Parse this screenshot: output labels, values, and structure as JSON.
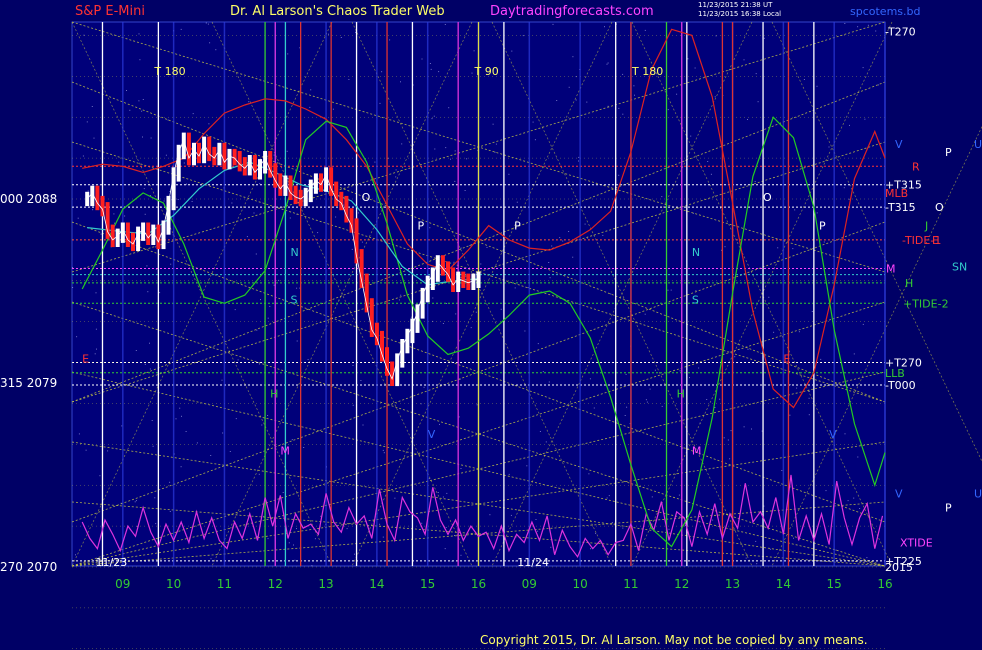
{
  "header": {
    "symbol": "S&P E-Mini",
    "title": "Dr. Al Larson's Chaos Trader Web",
    "site": "Daytradingforecasts.com",
    "stamp1": "11/23/2015 21:38 UT",
    "stamp2": "11/23/2015 16:38 Local",
    "file": "spcotems.bd"
  },
  "copyright": "Copyright 2015, Dr. Al Larson. May not be copied by any means.",
  "colors": {
    "background": "#000066",
    "plot_bg": "#00007a",
    "price_up": "#ffffff",
    "price_down": "#ff2020",
    "grid_yellow": "#d8d840",
    "red_line": "#dd2222",
    "green_line": "#22cc22",
    "cyan_line": "#33cccc",
    "magenta_line": "#dd33dd"
  },
  "chart_data": {
    "type": "line",
    "y_tick_labels": [
      {
        "text": "000  2088",
        "value": 2088
      },
      {
        "text": "315  2079",
        "value": 2079
      },
      {
        "text": "270  2070",
        "value": 2070
      }
    ],
    "ylim": [
      2070,
      2088
    ],
    "day_labels": [
      {
        "text": "11/23",
        "hour": 8.5
      },
      {
        "text": "11/24",
        "hour": 16.8
      }
    ],
    "x_ticks": [
      {
        "text": "09",
        "hour": 9
      },
      {
        "text": "10",
        "hour": 10
      },
      {
        "text": "11",
        "hour": 11
      },
      {
        "text": "12",
        "hour": 12
      },
      {
        "text": "13",
        "hour": 13
      },
      {
        "text": "14",
        "hour": 14
      },
      {
        "text": "15",
        "hour": 15
      },
      {
        "text": "16",
        "hour": 16
      },
      {
        "text": "09",
        "hour": 17
      },
      {
        "text": "10",
        "hour": 18
      },
      {
        "text": "11",
        "hour": 19
      },
      {
        "text": "12",
        "hour": 20
      },
      {
        "text": "13",
        "hour": 21
      },
      {
        "text": "14",
        "hour": 22
      },
      {
        "text": "15",
        "hour": 23
      },
      {
        "text": "16",
        "hour": 24
      }
    ],
    "time_markers": [
      {
        "text": "T   180",
        "hour": 9.7
      },
      {
        "text": "T   90",
        "hour": 16.0
      },
      {
        "text": "T   180",
        "hour": 19.1
      }
    ],
    "right_labels": [
      {
        "text": "-T270",
        "color": "#ffffff",
        "value": 2096.2
      },
      {
        "text": "V",
        "color": "#3366ff",
        "value": 2090.7
      },
      {
        "text": "P",
        "color": "#ffffff",
        "value": 2090.3
      },
      {
        "text": "U",
        "color": "#3366ff",
        "value": 2090.7
      },
      {
        "text": "R",
        "color": "#ff3333",
        "value": 2089.6
      },
      {
        "text": "+T315",
        "color": "#ffffff",
        "value": 2088.7
      },
      {
        "text": "MLB",
        "color": "#ff3333",
        "value": 2088.3
      },
      {
        "text": "O",
        "color": "#ffffff",
        "value": 2087.6
      },
      {
        "text": "-T315",
        "color": "#ffffff",
        "value": 2087.6
      },
      {
        "text": "J",
        "color": "#33cc33",
        "value": 2086.7
      },
      {
        "text": "-TIDE-1",
        "color": "#ff3333",
        "value": 2086.0
      },
      {
        "text": "E",
        "color": "#ff3333",
        "value": 2086.0
      },
      {
        "text": "M",
        "color": "#ff44ff",
        "value": 2084.6
      },
      {
        "text": "SN",
        "color": "#33cccc",
        "value": 2084.7
      },
      {
        "text": "H",
        "color": "#33cc33",
        "value": 2083.9
      },
      {
        "text": "+TIDE-2",
        "color": "#33cc33",
        "value": 2082.9
      },
      {
        "text": "+T270",
        "color": "#ffffff",
        "value": 2080.0
      },
      {
        "text": "LLB",
        "color": "#33cc33",
        "value": 2079.5
      },
      {
        "text": "-T000",
        "color": "#ffffff",
        "value": 2078.9
      },
      {
        "text": "V",
        "color": "#3366ff",
        "value": 2073.6
      },
      {
        "text": "P",
        "color": "#ffffff",
        "value": 2072.9
      },
      {
        "text": "U",
        "color": "#3366ff",
        "value": 2073.6
      },
      {
        "text": "XTIDE",
        "color": "#ff44ff",
        "value": 2071.2
      },
      {
        "text": "+T225",
        "color": "#ffffff",
        "value": 2070.3
      },
      {
        "text": "2015",
        "color": "#ffffff",
        "value": 2070.0
      }
    ],
    "plot_letters": [
      {
        "text": "O",
        "color": "#ffffff",
        "hour": 13.7,
        "value": 2087.9
      },
      {
        "text": "P",
        "color": "#ffffff",
        "hour": 14.8,
        "value": 2086.5
      },
      {
        "text": "N",
        "color": "#33cccc",
        "hour": 12.3,
        "value": 2085.2
      },
      {
        "text": "S",
        "color": "#33cccc",
        "hour": 12.3,
        "value": 2082.9
      },
      {
        "text": "H",
        "color": "#33cc33",
        "hour": 11.9,
        "value": 2078.3
      },
      {
        "text": "M",
        "color": "#ff44ff",
        "hour": 12.1,
        "value": 2075.5
      },
      {
        "text": "V",
        "color": "#3366ff",
        "hour": 15.0,
        "value": 2076.3
      },
      {
        "text": "P",
        "color": "#ffffff",
        "hour": 16.7,
        "value": 2086.5
      },
      {
        "text": "N",
        "color": "#33cccc",
        "hour": 20.2,
        "value": 2085.2
      },
      {
        "text": "S",
        "color": "#33cccc",
        "hour": 20.2,
        "value": 2082.9
      },
      {
        "text": "H",
        "color": "#33cc33",
        "hour": 19.9,
        "value": 2078.3
      },
      {
        "text": "M",
        "color": "#ff44ff",
        "hour": 20.2,
        "value": 2075.5
      },
      {
        "text": "O",
        "color": "#ffffff",
        "hour": 21.6,
        "value": 2087.9
      },
      {
        "text": "P",
        "color": "#ffffff",
        "hour": 22.7,
        "value": 2086.5
      },
      {
        "text": "V",
        "color": "#3366ff",
        "hour": 22.9,
        "value": 2076.3
      },
      {
        "text": "E",
        "color": "#ff3333",
        "hour": 22.0,
        "value": 2080.0
      },
      {
        "text": "E",
        "color": "#ff3333",
        "hour": 8.2,
        "value": 2080.0
      }
    ],
    "price_series": {
      "name": "",
      "x": [
        8.3,
        8.4,
        8.5,
        8.6,
        8.7,
        8.8,
        8.9,
        9.0,
        9.1,
        9.2,
        9.3,
        9.4,
        9.5,
        9.6,
        9.7,
        9.8,
        9.9,
        10.0,
        10.1,
        10.2,
        10.3,
        10.4,
        10.5,
        10.6,
        10.7,
        10.8,
        10.9,
        11.0,
        11.1,
        11.2,
        11.3,
        11.4,
        11.5,
        11.6,
        11.7,
        11.8,
        11.9,
        12.0,
        12.1,
        12.2,
        12.3,
        12.4,
        12.5,
        12.6,
        12.7,
        12.8,
        12.9,
        13.0,
        13.1,
        13.2,
        13.3,
        13.4,
        13.5,
        13.6,
        13.7,
        13.8,
        13.9,
        14.0,
        14.1,
        14.2,
        14.3,
        14.4,
        14.5,
        14.6,
        14.7,
        14.8,
        14.9,
        15.0,
        15.1,
        15.2,
        15.3,
        15.4,
        15.5,
        15.6,
        15.7,
        15.8,
        15.9,
        16.0
      ],
      "y": [
        2088.0,
        2088.3,
        2087.8,
        2087.5,
        2086.4,
        2086.0,
        2086.2,
        2086.5,
        2086.0,
        2085.8,
        2086.3,
        2086.5,
        2086.1,
        2086.4,
        2085.9,
        2086.6,
        2087.8,
        2089.2,
        2090.3,
        2090.9,
        2090.0,
        2090.4,
        2090.1,
        2090.7,
        2090.2,
        2090.0,
        2090.4,
        2089.8,
        2090.1,
        2090.0,
        2089.7,
        2089.5,
        2089.8,
        2089.3,
        2089.6,
        2090.0,
        2089.4,
        2088.9,
        2088.5,
        2088.8,
        2088.3,
        2088.1,
        2088.0,
        2088.2,
        2088.6,
        2088.9,
        2088.7,
        2089.2,
        2088.5,
        2088.0,
        2087.8,
        2087.2,
        2086.7,
        2085.2,
        2084.0,
        2082.8,
        2081.6,
        2081.2,
        2080.4,
        2079.7,
        2079.2,
        2080.1,
        2080.8,
        2081.3,
        2081.8,
        2082.5,
        2083.3,
        2083.9,
        2084.3,
        2084.9,
        2084.6,
        2084.3,
        2083.8,
        2084.1,
        2084.0,
        2083.9,
        2084.0,
        2084.1
      ]
    },
    "red_series": {
      "name": "",
      "x": [
        8.2,
        8.6,
        9.0,
        9.4,
        9.8,
        10.2,
        10.6,
        11.0,
        11.4,
        11.8,
        12.2,
        12.6,
        13.0,
        13.4,
        13.8,
        14.2,
        14.6,
        15.0,
        15.4,
        15.8,
        16.2,
        16.6,
        17.0,
        17.4,
        17.8,
        18.2,
        18.6,
        19.0,
        19.4,
        19.8,
        20.2,
        20.6,
        21.0,
        21.4,
        21.8,
        22.2,
        22.6,
        23.0,
        23.4,
        23.8,
        24.0
      ],
      "y": [
        2089.5,
        2089.7,
        2089.6,
        2089.3,
        2089.6,
        2090.0,
        2091.2,
        2092.2,
        2092.6,
        2092.9,
        2092.8,
        2092.4,
        2091.9,
        2090.9,
        2089.6,
        2087.7,
        2085.8,
        2084.8,
        2084.5,
        2085.5,
        2086.7,
        2086.0,
        2085.6,
        2085.5,
        2085.9,
        2086.5,
        2087.4,
        2090.3,
        2094.3,
        2096.3,
        2096.0,
        2093.0,
        2087.8,
        2082.5,
        2078.7,
        2077.8,
        2079.5,
        2083.8,
        2089.0,
        2091.3,
        2090.0
      ]
    },
    "green_series": {
      "name": "",
      "x": [
        8.2,
        8.6,
        9.0,
        9.4,
        9.8,
        10.2,
        10.6,
        11.0,
        11.4,
        11.8,
        12.2,
        12.6,
        13.0,
        13.4,
        13.8,
        14.2,
        14.6,
        15.0,
        15.4,
        15.8,
        16.2,
        16.6,
        17.0,
        17.4,
        17.8,
        18.2,
        18.6,
        19.0,
        19.4,
        19.8,
        20.2,
        20.6,
        21.0,
        21.4,
        21.8,
        22.2,
        22.6,
        23.0,
        23.4,
        23.8,
        24.0
      ],
      "y": [
        2083.6,
        2085.5,
        2087.5,
        2088.3,
        2087.8,
        2085.8,
        2083.2,
        2082.9,
        2083.3,
        2084.5,
        2087.5,
        2090.9,
        2091.8,
        2091.5,
        2089.8,
        2086.8,
        2083.3,
        2081.3,
        2080.4,
        2080.7,
        2081.4,
        2082.3,
        2083.3,
        2083.5,
        2082.9,
        2081.2,
        2078.3,
        2075.0,
        2071.9,
        2071.0,
        2072.8,
        2077.3,
        2083.4,
        2089.1,
        2092.0,
        2091.0,
        2087.6,
        2081.6,
        2077.0,
        2074.0,
        2075.6
      ]
    },
    "cyan_series": {
      "name": "",
      "x": [
        8.3,
        9.0,
        9.5,
        10.0,
        10.5,
        11.0,
        11.5,
        12.0,
        12.5,
        13.0,
        13.5,
        14.0,
        14.5,
        15.0,
        15.5,
        16.0
      ],
      "y": [
        2086.6,
        2086.4,
        2086.3,
        2087.2,
        2088.5,
        2089.4,
        2089.8,
        2089.3,
        2088.7,
        2088.4,
        2087.9,
        2086.5,
        2084.7,
        2083.8,
        2084.0,
        2084.1
      ]
    },
    "magenta_series": {
      "name": "XTIDE",
      "x": [
        8.2,
        8.35,
        8.5,
        8.65,
        8.8,
        8.95,
        9.1,
        9.25,
        9.4,
        9.55,
        9.7,
        9.85,
        10.0,
        10.15,
        10.3,
        10.45,
        10.6,
        10.75,
        10.9,
        11.05,
        11.2,
        11.35,
        11.5,
        11.65,
        11.8,
        11.95,
        12.1,
        12.25,
        12.4,
        12.55,
        12.7,
        12.85,
        13.0,
        13.15,
        13.3,
        13.45,
        13.6,
        13.75,
        13.9,
        14.05,
        14.2,
        14.35,
        14.5,
        14.65,
        14.8,
        14.95,
        15.1,
        15.25,
        15.4,
        15.55,
        15.7,
        15.85,
        16.0,
        16.15,
        16.3,
        16.45,
        16.6,
        16.75,
        16.9,
        17.05,
        17.2,
        17.35,
        17.5,
        17.65,
        17.8,
        17.95,
        18.1,
        18.25,
        18.4,
        18.55,
        18.7,
        18.85,
        19.0,
        19.15,
        19.3,
        19.45,
        19.6,
        19.75,
        19.9,
        20.05,
        20.2,
        20.35,
        20.5,
        20.65,
        20.8,
        20.95,
        21.1,
        21.25,
        21.4,
        21.55,
        21.7,
        21.85,
        22.0,
        22.15,
        22.3,
        22.45,
        22.6,
        22.75,
        22.9,
        23.05,
        23.2,
        23.35,
        23.5,
        23.65,
        23.8,
        23.95
      ],
      "y": [
        2072.2,
        2071.4,
        2070.9,
        2072.3,
        2071.6,
        2070.8,
        2072.0,
        2071.5,
        2072.9,
        2071.7,
        2071.0,
        2072.1,
        2071.3,
        2072.2,
        2071.2,
        2072.7,
        2071.4,
        2072.4,
        2071.3,
        2070.9,
        2072.2,
        2071.4,
        2072.6,
        2071.3,
        2073.4,
        2072.0,
        2073.5,
        2071.4,
        2072.6,
        2071.9,
        2072.1,
        2071.6,
        2073.6,
        2072.2,
        2071.7,
        2072.9,
        2072.1,
        2072.5,
        2071.4,
        2073.8,
        2072.1,
        2071.3,
        2073.4,
        2072.7,
        2072.4,
        2071.6,
        2073.9,
        2072.3,
        2071.6,
        2072.3,
        2071.3,
        2072.0,
        2071.5,
        2071.7,
        2070.9,
        2072.0,
        2070.8,
        2071.6,
        2071.2,
        2072.2,
        2071.3,
        2072.5,
        2070.6,
        2071.8,
        2071.0,
        2070.5,
        2071.4,
        2070.9,
        2071.3,
        2070.6,
        2071.2,
        2071.3,
        2072.1,
        2070.8,
        2072.6,
        2071.8,
        2073.2,
        2071.3,
        2072.7,
        2072.4,
        2071.0,
        2072.7,
        2071.6,
        2073.1,
        2071.4,
        2072.6,
        2071.9,
        2074.1,
        2072.2,
        2072.7,
        2071.9,
        2073.4,
        2071.6,
        2074.5,
        2071.3,
        2072.5,
        2071.3,
        2072.6,
        2071.1,
        2074.2,
        2072.4,
        2071.1,
        2072.4,
        2073.1,
        2070.9,
        2072.5
      ]
    },
    "vertical_lines": [
      {
        "hour": 8.6,
        "color": "#ffffff"
      },
      {
        "hour": 9.7,
        "color": "#ffffff"
      },
      {
        "hour": 11.8,
        "color": "#33cc33"
      },
      {
        "hour": 12.2,
        "color": "#33cccc"
      },
      {
        "hour": 12.0,
        "color": "#dd33dd"
      },
      {
        "hour": 12.5,
        "color": "#dd3333"
      },
      {
        "hour": 13.1,
        "color": "#dd3333"
      },
      {
        "hour": 13.6,
        "color": "#ffffff"
      },
      {
        "hour": 14.2,
        "color": "#dd3333"
      },
      {
        "hour": 14.7,
        "color": "#ffffff"
      },
      {
        "hour": 15.6,
        "color": "#dd33dd"
      },
      {
        "hour": 16.0,
        "color": "#dddd44"
      },
      {
        "hour": 16.5,
        "color": "#ffffff"
      },
      {
        "hour": 18.7,
        "color": "#ffffff"
      },
      {
        "hour": 19.0,
        "color": "#dd3333"
      },
      {
        "hour": 19.7,
        "color": "#33cc33"
      },
      {
        "hour": 20.1,
        "color": "#ffffff"
      },
      {
        "hour": 20.0,
        "color": "#dd33dd"
      },
      {
        "hour": 20.8,
        "color": "#dd3333"
      },
      {
        "hour": 21.0,
        "color": "#dd3333"
      },
      {
        "hour": 21.6,
        "color": "#ffffff"
      },
      {
        "hour": 22.1,
        "color": "#dd3333"
      },
      {
        "hour": 22.6,
        "color": "#ffffff"
      }
    ],
    "horizontal_lines": [
      {
        "value": 2089.6,
        "color": "#ff3333"
      },
      {
        "value": 2088.7,
        "color": "#ffffff"
      },
      {
        "value": 2087.6,
        "color": "#ffffff"
      },
      {
        "value": 2086.0,
        "color": "#ff3333"
      },
      {
        "value": 2084.6,
        "color": "#ff44ff"
      },
      {
        "value": 2084.3,
        "color": "#33cccc"
      },
      {
        "value": 2083.9,
        "color": "#33cc33"
      },
      {
        "value": 2082.9,
        "color": "#33cc33"
      },
      {
        "value": 2080.0,
        "color": "#ffffff"
      },
      {
        "value": 2079.5,
        "color": "#33cc33"
      },
      {
        "value": 2078.9,
        "color": "#ffffff"
      },
      {
        "value": 2070.3,
        "color": "#ffffff"
      }
    ],
    "grid": true
  }
}
